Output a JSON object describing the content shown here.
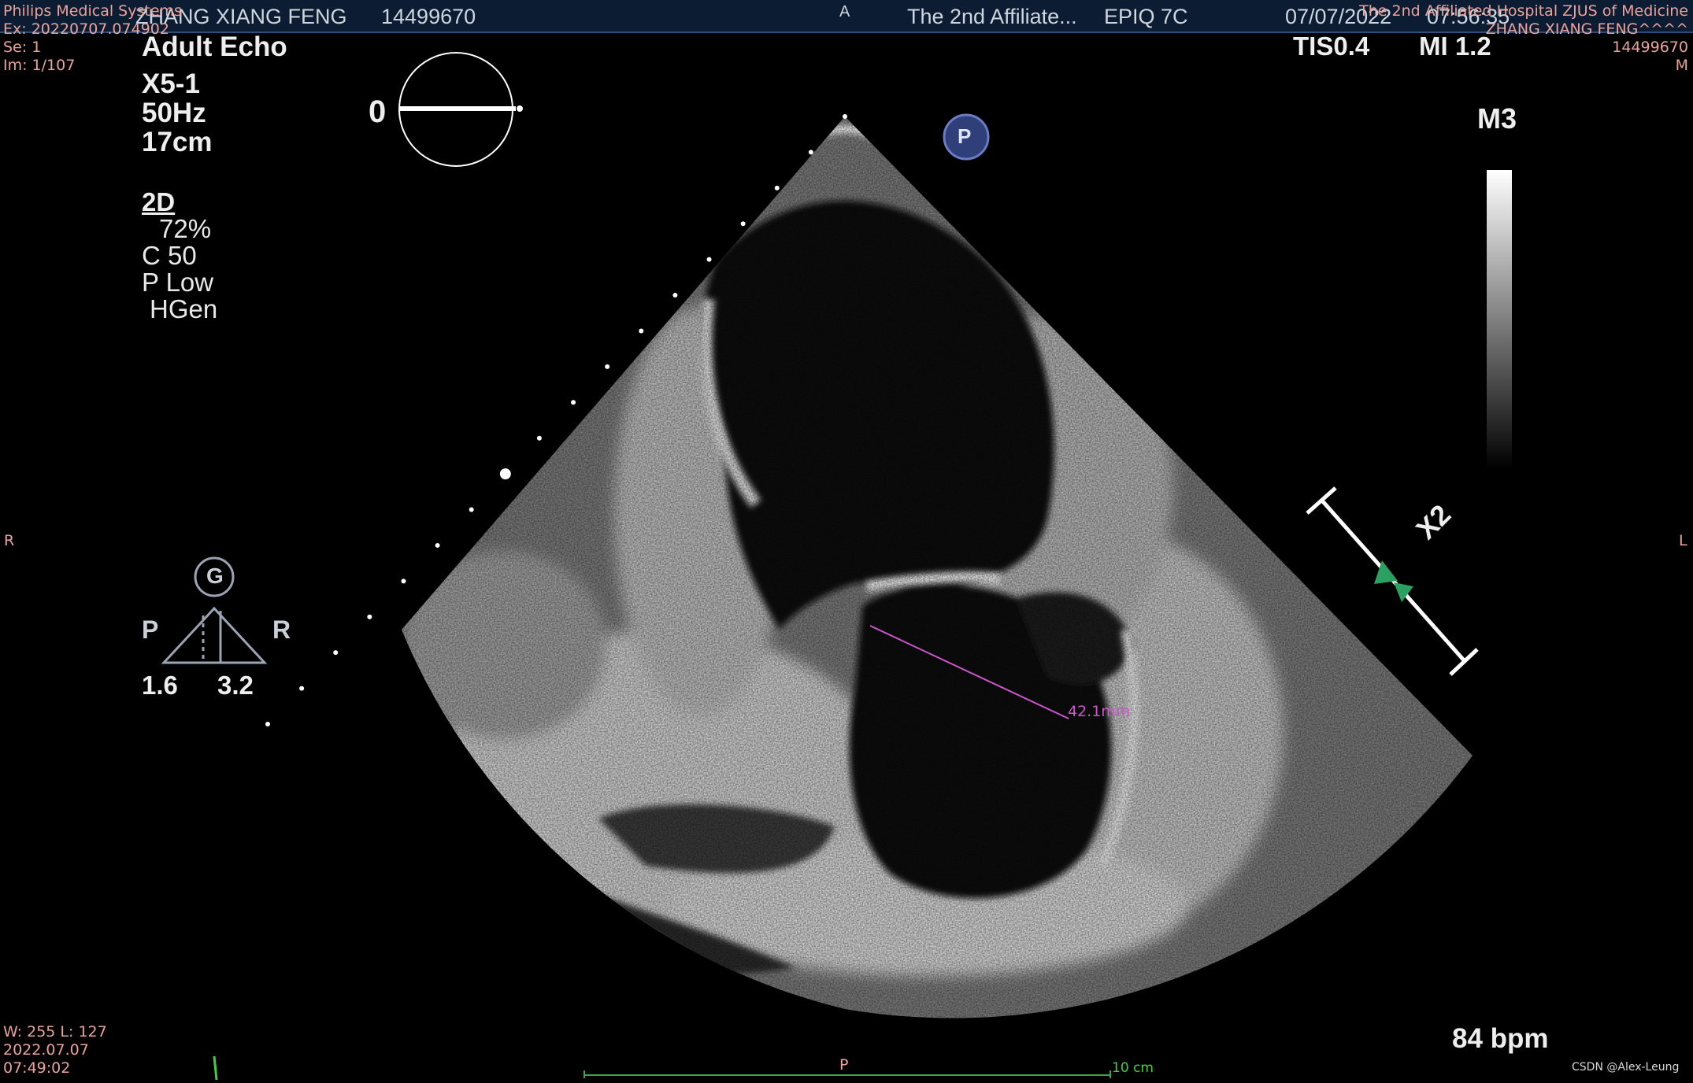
{
  "header": {
    "patient_name": "ZHANG XIANG FENG",
    "patient_id": "14499670",
    "orientation_top": "A",
    "hospital_short": "The 2nd Affiliate...",
    "system_model": "EPIQ 7C",
    "date": "07/07/2022",
    "time": "07:56:35"
  },
  "dicom_left": {
    "manufacturer": "Philips Medical Systems",
    "exam": "Ex: 20220707.074902",
    "series": "Se: 1",
    "image": "Im: 1/107"
  },
  "dicom_right": {
    "institution": "The 2nd Affiliated Hospital ZJUS of Medicine",
    "patient_name_dicom": "ZHANG XIANG FENG^^^^",
    "patient_id": "14499670",
    "sex": "M"
  },
  "exam_params": {
    "preset": "Adult Echo",
    "transducer": "X5-1",
    "frame_rate": "50Hz",
    "depth": "17cm",
    "mode": "2D",
    "gain": "72%",
    "compression": "C 50",
    "power": "P Low",
    "frequency": "HGen"
  },
  "safety": {
    "tis": "TIS0.4",
    "mi": "MI 1.2"
  },
  "gray_map": {
    "label": "M3"
  },
  "rotation": {
    "angle_label": "0"
  },
  "probe_marker": {
    "label": "P"
  },
  "orientation": {
    "left": "R",
    "right": "L",
    "bottom": "P"
  },
  "tee_icon": {
    "badge": "G",
    "left_label": "P",
    "right_label": "R",
    "value_left": "1.6",
    "value_right": "3.2"
  },
  "zoom": {
    "label": "X2"
  },
  "measurement": {
    "label": "42.1mm",
    "color": "#cc55cc"
  },
  "window_level": {
    "wl": "W: 255 L: 127",
    "date": "2022.07.07",
    "time": "07:49:02"
  },
  "scale_bar": {
    "label": "10 cm"
  },
  "heart_rate": {
    "value": "84 bpm"
  },
  "watermark": {
    "text": "CSDN @Alex-Leung"
  }
}
